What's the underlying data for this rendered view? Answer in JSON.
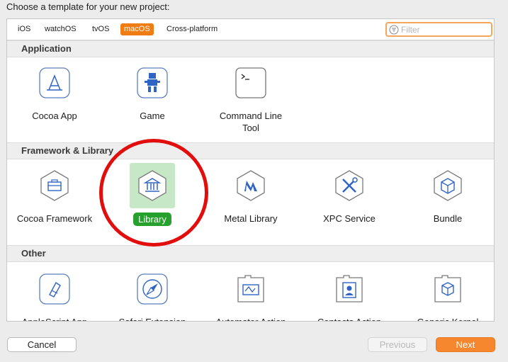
{
  "heading": "Choose a template for your new project:",
  "tabs": [
    {
      "label": "iOS"
    },
    {
      "label": "watchOS"
    },
    {
      "label": "tvOS"
    },
    {
      "label": "macOS",
      "active": true
    },
    {
      "label": "Cross-platform"
    }
  ],
  "filter": {
    "placeholder": "Filter"
  },
  "sections": {
    "application": {
      "title": "Application",
      "items": [
        {
          "label": "Cocoa App",
          "icon": "app-store-icon"
        },
        {
          "label": "Game",
          "icon": "game-sprite-icon"
        },
        {
          "label": "Command Line\nTool",
          "icon": "terminal-icon"
        }
      ]
    },
    "framework": {
      "title": "Framework & Library",
      "items": [
        {
          "label": "Cocoa Framework",
          "icon": "toolbox-icon"
        },
        {
          "label": "Library",
          "icon": "library-icon",
          "selected": true
        },
        {
          "label": "Metal Library",
          "icon": "metal-icon"
        },
        {
          "label": "XPC Service",
          "icon": "tools-icon"
        },
        {
          "label": "Bundle",
          "icon": "bundle-icon"
        }
      ]
    },
    "other": {
      "title": "Other",
      "items": [
        {
          "label": "AppleScript App",
          "icon": "applescript-icon"
        },
        {
          "label": "Safari Extension",
          "icon": "compass-icon"
        },
        {
          "label": "Automator Action",
          "icon": "automator-icon"
        },
        {
          "label": "Contacts Action",
          "icon": "contacts-icon"
        },
        {
          "label": "Generic Kernel",
          "icon": "kernel-icon"
        }
      ]
    }
  },
  "buttons": {
    "cancel": "Cancel",
    "previous": "Previous",
    "next": "Next"
  },
  "colors": {
    "accent": "#f07c12",
    "selection": "#27a12e",
    "annotation": "#e20e0e"
  }
}
